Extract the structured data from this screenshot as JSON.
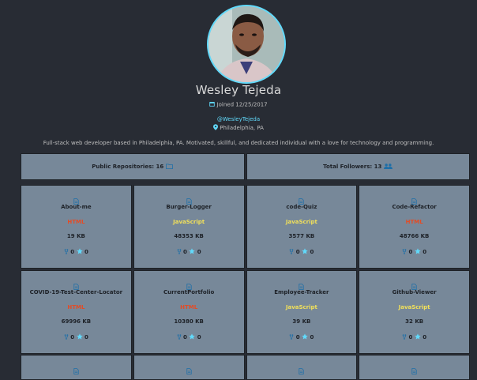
{
  "profile": {
    "name": "Wesley Tejeda",
    "joined": "Joined 12/25/2017",
    "handle": "@WesleyTejeda",
    "location": "Philadelphia, PA",
    "bio": "Full-stack web developer based in Philadelphia, PA. Motivated, skillful, and dedicated individual with a love for technology and programming.",
    "avatar_alt": "profile photo"
  },
  "stats": {
    "repos_label": "Public Repositories: 16",
    "followers_label": "Total Followers: 13"
  },
  "icons": {
    "calendar": "calendar-icon",
    "pin": "map-pin-icon",
    "folder": "folder-icon",
    "users": "users-icon",
    "file": "file-icon",
    "fork": "fork-icon",
    "star": "star-icon"
  },
  "colors": {
    "background": "#282c34",
    "card": "#778899",
    "accent": "#61dafb",
    "html": "#e34c26",
    "javascript": "#f1e05a"
  },
  "repos": [
    {
      "name": "About-me",
      "language": "HTML",
      "size": "19 KB",
      "forks": "0",
      "stars": "0"
    },
    {
      "name": "Burger-Logger",
      "language": "JavaScript",
      "size": "48353 KB",
      "forks": "0",
      "stars": "0"
    },
    {
      "name": "code-Quiz",
      "language": "JavaScript",
      "size": "3577 KB",
      "forks": "0",
      "stars": "0"
    },
    {
      "name": "Code-Refactor",
      "language": "HTML",
      "size": "48766 KB",
      "forks": "0",
      "stars": "0"
    },
    {
      "name": "COVID-19-Test-Center-Locator",
      "language": "HTML",
      "size": "69996 KB",
      "forks": "0",
      "stars": "0"
    },
    {
      "name": "CurrentPortfolio",
      "language": "HTML",
      "size": "10380 KB",
      "forks": "0",
      "stars": "0"
    },
    {
      "name": "Employee-Tracker",
      "language": "JavaScript",
      "size": "39 KB",
      "forks": "0",
      "stars": "0"
    },
    {
      "name": "Github-Viewer",
      "language": "JavaScript",
      "size": "32 KB",
      "forks": "0",
      "stars": "0"
    }
  ]
}
